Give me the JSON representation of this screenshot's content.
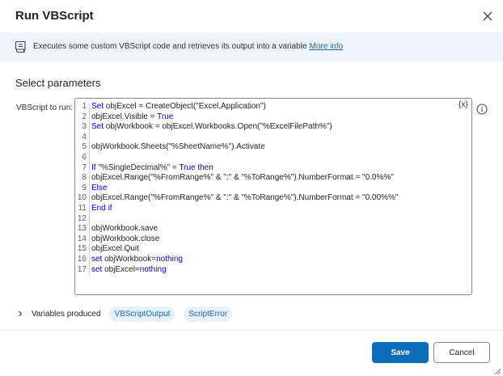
{
  "dialog": {
    "title": "Run VBScript",
    "close_icon": "close-icon"
  },
  "info": {
    "icon": "script-icon",
    "text": "Executes some custom VBScript code and retrieves its output into a variable",
    "link_text": "More info"
  },
  "parameters": {
    "section_title": "Select parameters",
    "vbscript_label": "VBScript to run:",
    "variable_token": "{x}",
    "help_icon": "info-icon"
  },
  "code": {
    "lines": [
      {
        "n": "1",
        "parts": [
          {
            "t": "Set",
            "k": true
          },
          {
            "t": " objExcel = CreateObject(\"Excel.Application\")"
          }
        ]
      },
      {
        "n": "2",
        "parts": [
          {
            "t": "objExcel.Visible = "
          },
          {
            "t": "True",
            "k": true
          }
        ]
      },
      {
        "n": "3",
        "parts": [
          {
            "t": "Set",
            "k": true
          },
          {
            "t": " objWorkbook = objExcel.Workbooks.Open(\"%ExcelFilePath%\")"
          }
        ]
      },
      {
        "n": "4",
        "parts": []
      },
      {
        "n": "5",
        "parts": [
          {
            "t": "objWorkbook.Sheets(\"%SheetName%\").Activate"
          }
        ]
      },
      {
        "n": "6",
        "parts": []
      },
      {
        "n": "7",
        "parts": [
          {
            "t": "If",
            "k": true
          },
          {
            "t": " \"%SingleDecimal%\" = "
          },
          {
            "t": "True then",
            "k": true
          }
        ]
      },
      {
        "n": "8",
        "parts": [
          {
            "t": "objExcel.Range(\"%FromRange%\" & \":\" & \"%ToRange%\").NumberFormat = \"0.0%%\""
          }
        ]
      },
      {
        "n": "9",
        "parts": [
          {
            "t": "Else",
            "k": true
          }
        ]
      },
      {
        "n": "10",
        "parts": [
          {
            "t": "objExcel.Range(\"%FromRange%\" & \":\" & \"%ToRange%\").NumberFormat = \"0.00%%\""
          }
        ]
      },
      {
        "n": "11",
        "parts": [
          {
            "t": "End if",
            "k": true
          }
        ]
      },
      {
        "n": "12",
        "parts": []
      },
      {
        "n": "13",
        "parts": [
          {
            "t": "objWorkbook.save"
          }
        ]
      },
      {
        "n": "14",
        "parts": [
          {
            "t": "objWorkbook.close"
          }
        ]
      },
      {
        "n": "15",
        "parts": [
          {
            "t": "objExcel.Quit"
          }
        ]
      },
      {
        "n": "16",
        "parts": [
          {
            "t": "set",
            "k": true
          },
          {
            "t": " objWorkbook="
          },
          {
            "t": "nothing",
            "k": true
          }
        ]
      },
      {
        "n": "17",
        "parts": [
          {
            "t": "set",
            "k": true
          },
          {
            "t": " objExcel="
          },
          {
            "t": "nothing",
            "k": true
          }
        ]
      }
    ]
  },
  "variables": {
    "label": "Variables produced",
    "items": [
      "VBScriptOutput",
      "ScriptError"
    ]
  },
  "footer": {
    "save_label": "Save",
    "cancel_label": "Cancel"
  },
  "colors": {
    "accent": "#0f6cbd",
    "keyword": "#0000e6",
    "info_bar": "#eff4fb",
    "pill_bg": "#e8f1fb"
  }
}
